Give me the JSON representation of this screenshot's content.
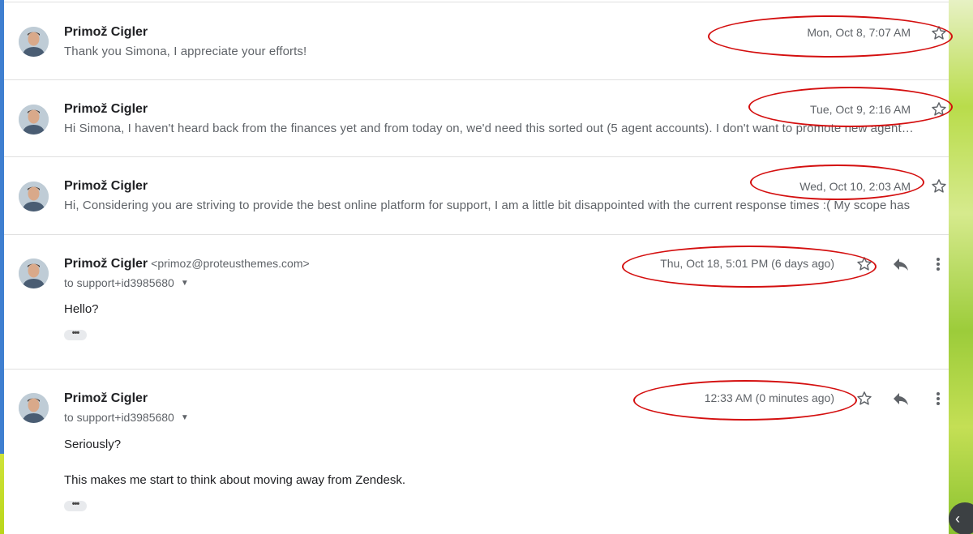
{
  "messages": [
    {
      "sender": "Primož Cigler",
      "snippet": "Thank you Simona, I appreciate your efforts!",
      "date": "Mon, Oct 8, 7:07 AM"
    },
    {
      "sender": "Primož Cigler",
      "snippet": "Hi Simona, I haven't heard back from the finances yet and from today on, we'd need this sorted out (5 agent accounts). I don't want to promote new agent…",
      "date": "Tue, Oct 9, 2:16 AM"
    },
    {
      "sender": "Primož Cigler",
      "snippet": "Hi, Considering you are striving to provide the best online platform for support, I am a little bit disappointed with the current response times :( My scope has",
      "date": "Wed, Oct 10, 2:03 AM"
    },
    {
      "sender": "Primož Cigler",
      "email": "<primoz@proteusthemes.com>",
      "to": "to support+id3985680",
      "date": "Thu, Oct 18, 5:01 PM (6 days ago)",
      "body": [
        "Hello?"
      ]
    },
    {
      "sender": "Primož Cigler",
      "to": "to support+id3985680",
      "date": "12:33 AM (0 minutes ago)",
      "body": [
        "Seriously?",
        "This makes me start to think about moving away from Zendesk."
      ]
    }
  ],
  "icons": {
    "star": "star-outline-icon",
    "reply": "reply-arrow-icon",
    "more": "more-vert-icon",
    "expand": "more-horiz-icon",
    "side_panel": "chevron-left-icon"
  },
  "ui": {
    "expand_dots": "•••",
    "side_toggle_glyph": "‹"
  },
  "colors": {
    "annotation_ring": "#d40f0f",
    "text_secondary": "#5f6368",
    "divider": "#e0e0e0"
  }
}
